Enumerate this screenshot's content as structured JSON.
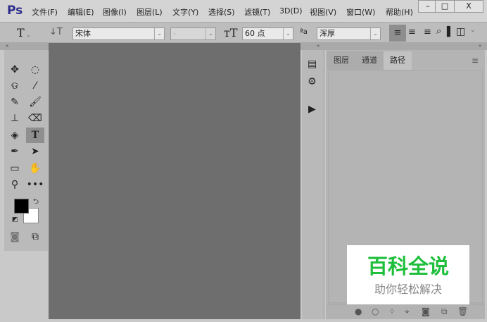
{
  "app": {
    "logo": "Ps"
  },
  "menu": [
    "文件(F)",
    "编辑(E)",
    "图像(I)",
    "图层(L)",
    "文字(Y)",
    "选择(S)",
    "滤镜(T)",
    "3D(D)",
    "视图(V)",
    "窗口(W)",
    "帮助(H)"
  ],
  "window_controls": {
    "minimize": "–",
    "maximize": "□",
    "close": "X"
  },
  "options": {
    "font_family": "宋体",
    "font_style": "-",
    "font_size": "60 点",
    "antialias": "浑厚"
  },
  "panel": {
    "tabs": [
      "图层",
      "通道",
      "路径"
    ],
    "active_tab": "路径"
  },
  "colors": {
    "foreground": "#000000",
    "background": "#ffffff",
    "accent": "#2d2d8c"
  },
  "watermark": {
    "title": "百科全说",
    "subtitle": "助你轻松解决"
  }
}
